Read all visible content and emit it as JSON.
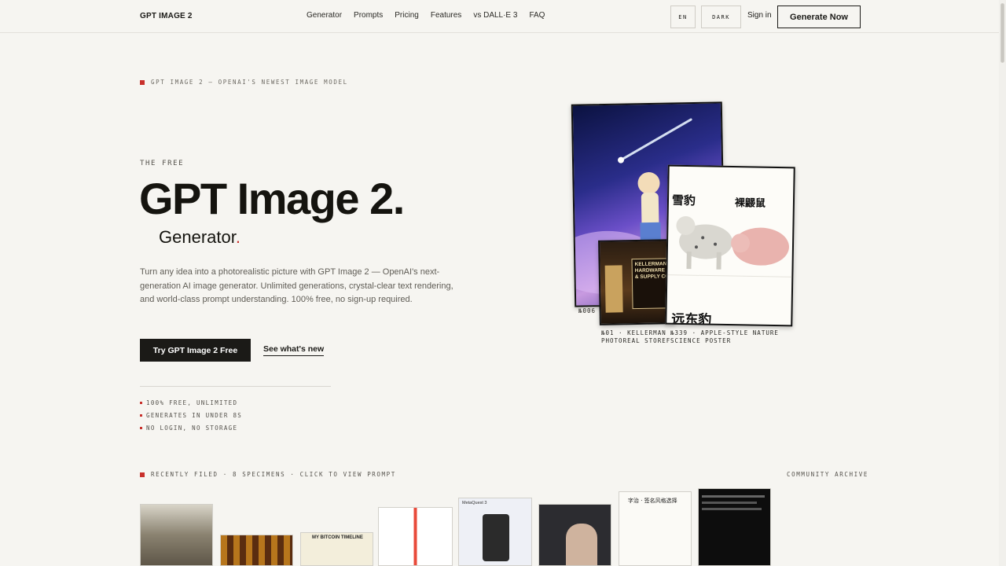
{
  "header": {
    "logo": "GPT IMAGE 2",
    "nav": [
      "Generator",
      "Prompts",
      "Pricing",
      "Features",
      "vs DALL·E 3",
      "FAQ"
    ],
    "lang_label": "EN",
    "theme_label": "DARK",
    "signin_label": "Sign in",
    "cta_label": "Generate Now"
  },
  "hero": {
    "eyebrow": "GPT IMAGE 2 — OPENAI'S NEWEST IMAGE MODEL",
    "kicker": "THE FREE",
    "title": "GPT Image 2.",
    "subtitle": "Generator",
    "subtitle_dot": ".",
    "description": "Turn any idea into a photorealistic picture with GPT Image 2 — OpenAI's next-generation AI image generator. Unlimited generations, crystal-clear text rendering, and world-class prompt understanding. 100% free, no sign-up required.",
    "primary_cta": "Try GPT Image 2 Free",
    "secondary_cta": "See what's new",
    "bullets": [
      "100% FREE, UNLIMITED",
      "GENERATES IN UNDER 8S",
      "NO LOGIN, NO STORAGE"
    ]
  },
  "collage": {
    "cosmic_caption": "№006",
    "store_caption": "№01 · KELLERMAN",
    "store_caption_2": "PHOTOREAL STOREFRO",
    "poster_caption": "№339 · APPLE-STYLE NATURE",
    "poster_caption_2": "SCIENCE POSTER",
    "store_sign": "KELLERMAN HARDWARE & SUPPLY CO",
    "poster_title_left": "雪豹",
    "poster_title_right": "裸鼹鼠",
    "poster_bottom": "远东豹"
  },
  "gallery": {
    "heading": "RECENTLY FILED · 8 SPECIMENS · CLICK TO VIEW PROMPT",
    "archive_label": "COMMUNITY ARCHIVE",
    "thumb_3_text": "MY BITCOIN TIMELINE",
    "thumb_5_text": "MetaQuest 3",
    "thumb_7_text": "字治 · 签名风格选择"
  },
  "colors": {
    "accent": "#c8302b",
    "ink": "#1b1a17",
    "background": "#f6f5f1"
  }
}
